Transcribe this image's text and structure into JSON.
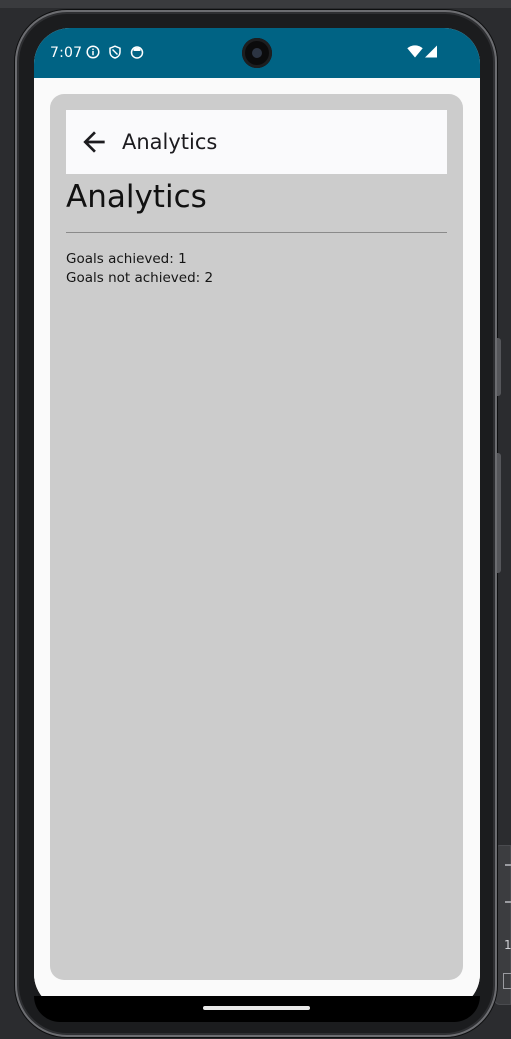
{
  "status_bar": {
    "time": "7:07",
    "icons": [
      "info-icon",
      "shield-icon",
      "app-notification-icon"
    ],
    "right_icons": [
      "wifi-icon",
      "cell-signal-icon"
    ],
    "color": "#006384"
  },
  "app_bar": {
    "back_icon": "arrow-back-icon",
    "title": "Analytics"
  },
  "page": {
    "heading": "Analytics",
    "goals_achieved": "Goals achieved: 1",
    "goals_not_achieved": "Goals not achieved: 2"
  },
  "colors": {
    "card_background": "#cccccc",
    "screen_background": "#fafafa"
  }
}
